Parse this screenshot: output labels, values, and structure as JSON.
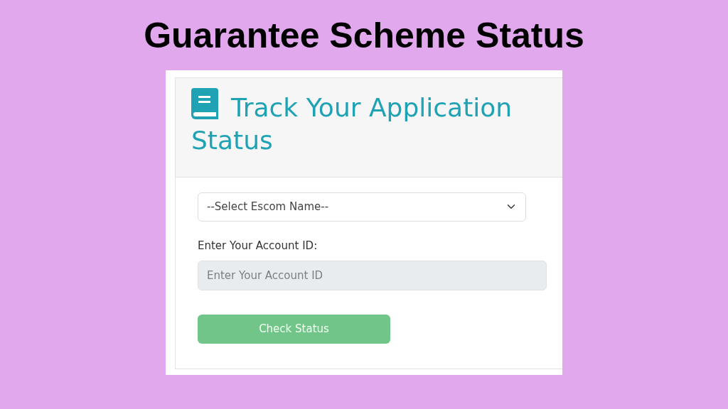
{
  "title": "Guarantee Scheme Status",
  "card": {
    "heading": "Track Your Application Status",
    "select": {
      "placeholder": "--Select Escom Name--"
    },
    "account_label": "Enter Your Account ID:",
    "account_field": {
      "placeholder": "Enter Your Account ID",
      "disabled": true
    },
    "button": {
      "label": "Check Status",
      "disabled": true
    }
  }
}
